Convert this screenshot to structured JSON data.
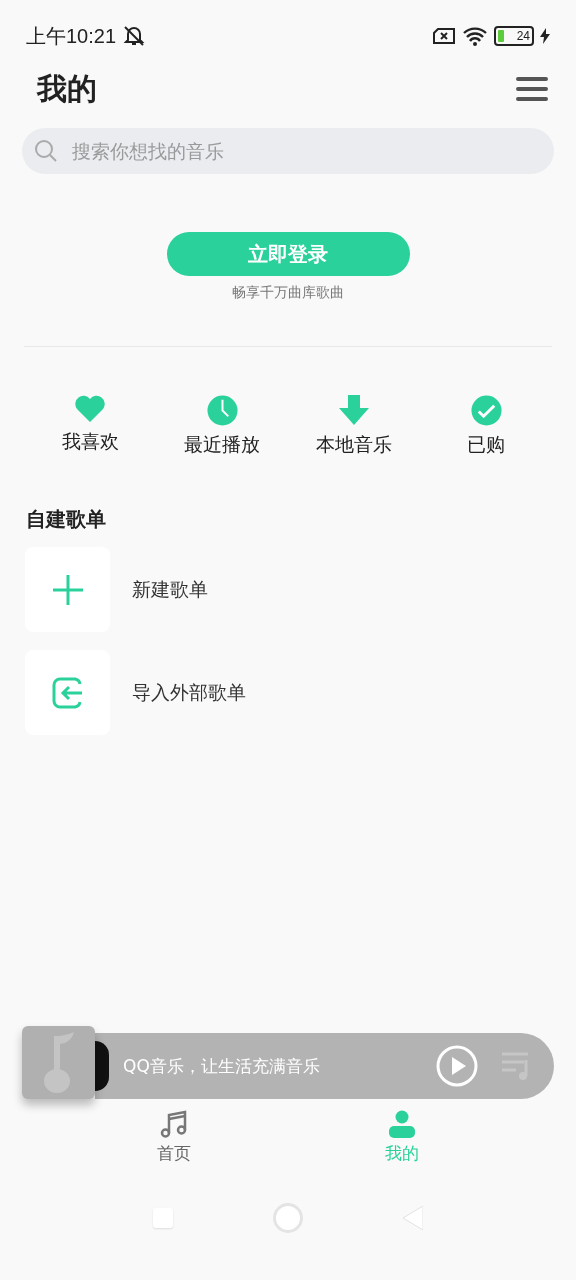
{
  "status_bar": {
    "time": "上午10:21",
    "battery": "24"
  },
  "header": {
    "title": "我的"
  },
  "search": {
    "placeholder": "搜索你想找的音乐"
  },
  "login": {
    "button": "立即登录",
    "subtitle": "畅享千万曲库歌曲"
  },
  "quick_actions": [
    {
      "kind": "heart",
      "label": "我喜欢"
    },
    {
      "kind": "clock",
      "label": "最近播放"
    },
    {
      "kind": "download",
      "label": "本地音乐"
    },
    {
      "kind": "check",
      "label": "已购"
    }
  ],
  "playlists": {
    "title": "自建歌单",
    "items": [
      {
        "kind": "create",
        "label": "新建歌单"
      },
      {
        "kind": "import",
        "label": "导入外部歌单"
      }
    ]
  },
  "player": {
    "text": "QQ音乐，让生活充满音乐"
  },
  "tabs": [
    {
      "kind": "home",
      "label": "首页",
      "selected": false
    },
    {
      "kind": "profile",
      "label": "我的",
      "selected": true
    }
  ]
}
